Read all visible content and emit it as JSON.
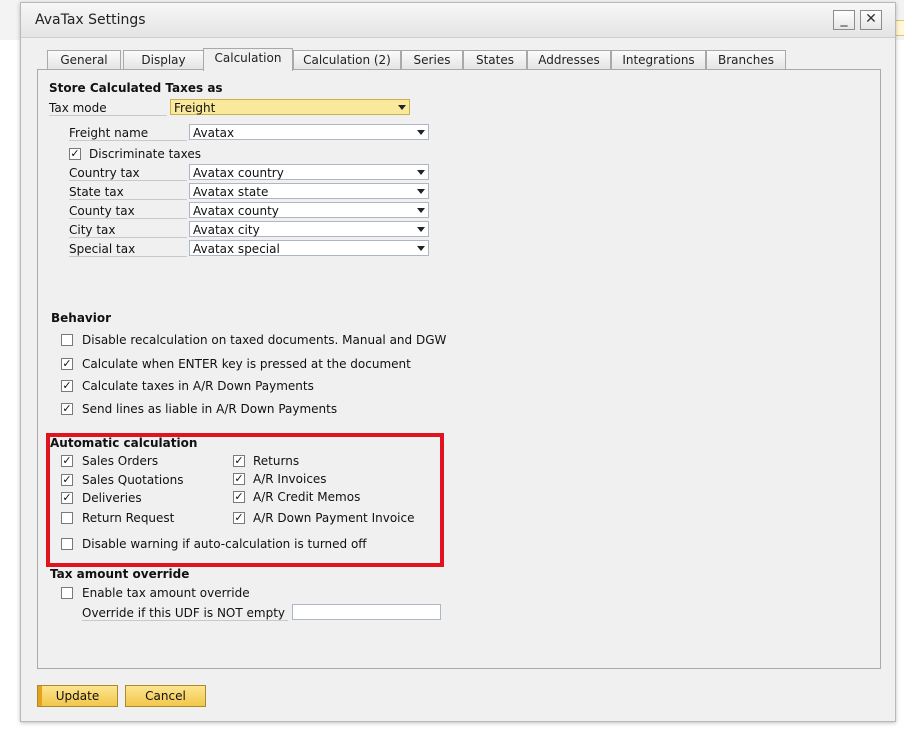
{
  "window": {
    "title": "AvaTax Settings",
    "minimize_label": "_",
    "close_label": "✕"
  },
  "tabs": [
    {
      "label": "General"
    },
    {
      "label": "Display"
    },
    {
      "label": "Calculation"
    },
    {
      "label": "Calculation (2)"
    },
    {
      "label": "Series"
    },
    {
      "label": "States"
    },
    {
      "label": "Addresses"
    },
    {
      "label": "Integrations"
    },
    {
      "label": "Branches"
    }
  ],
  "active_tab": "Calculation",
  "store": {
    "title": "Store Calculated Taxes as",
    "tax_mode_label": "Tax mode",
    "tax_mode_value": "Freight",
    "freight_name_label": "Freight name",
    "freight_name_value": "Avatax",
    "discriminate_label": "Discriminate taxes",
    "discriminate_checked": true,
    "rows": [
      {
        "label": "Country tax",
        "value": "Avatax country"
      },
      {
        "label": "State tax",
        "value": "Avatax state"
      },
      {
        "label": "County tax",
        "value": "Avatax county"
      },
      {
        "label": "City tax",
        "value": "Avatax city"
      },
      {
        "label": "Special tax",
        "value": "Avatax special"
      }
    ]
  },
  "behavior": {
    "title": "Behavior",
    "items": [
      {
        "label": "Disable recalculation on taxed documents. Manual and DGW",
        "checked": false
      },
      {
        "label": "Calculate when ENTER key is pressed at the document",
        "checked": true
      },
      {
        "label": "Calculate taxes in A/R Down Payments",
        "checked": true
      },
      {
        "label": "Send lines as liable in A/R Down Payments",
        "checked": true
      }
    ]
  },
  "auto": {
    "title": "Automatic calculation",
    "left": [
      {
        "label": "Sales Orders",
        "checked": true
      },
      {
        "label": "Sales Quotations",
        "checked": true
      },
      {
        "label": "Deliveries",
        "checked": true
      },
      {
        "label": "Return Request",
        "checked": false
      }
    ],
    "right": [
      {
        "label": "Returns",
        "checked": true
      },
      {
        "label": "A/R Invoices",
        "checked": true
      },
      {
        "label": "A/R Credit Memos",
        "checked": true
      },
      {
        "label": "A/R Down Payment Invoice",
        "checked": true
      }
    ],
    "disable_warning_label": "Disable warning if auto-calculation is turned off",
    "disable_warning_checked": false
  },
  "override": {
    "title": "Tax amount override",
    "enable_label": "Enable tax amount override",
    "enable_checked": false,
    "udf_label": "Override if this UDF is NOT empty",
    "udf_value": ""
  },
  "buttons": {
    "update": "Update",
    "cancel": "Cancel"
  },
  "colors": {
    "highlight": "#e0141f",
    "button": "#f2c74a",
    "combo_yellow": "#fbe99b"
  },
  "check_glyph": "✓"
}
